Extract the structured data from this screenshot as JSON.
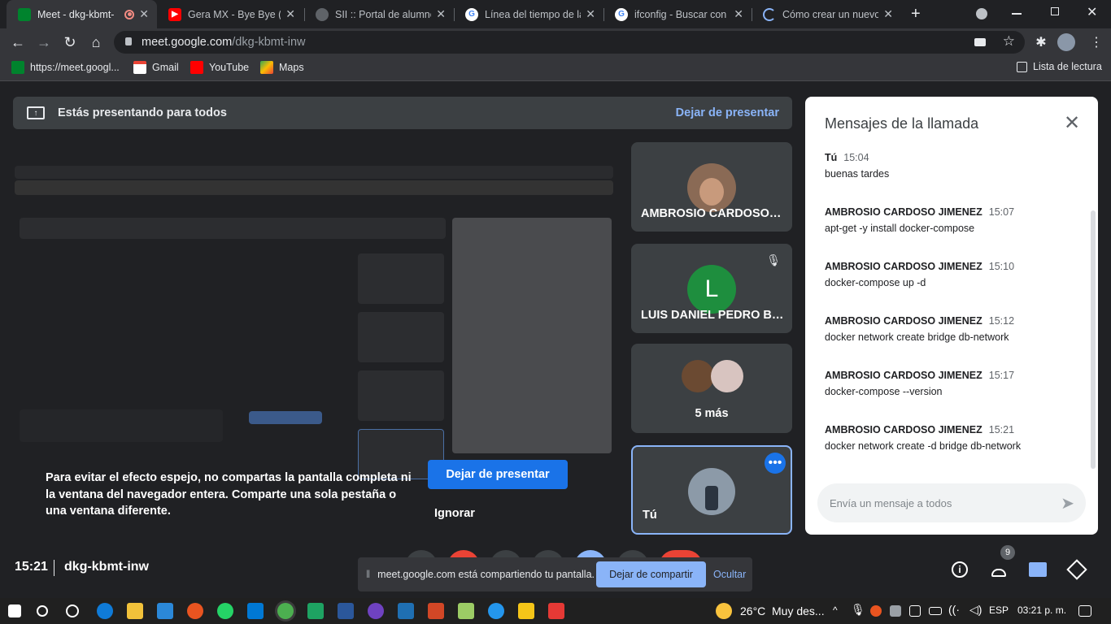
{
  "browser": {
    "tabs": [
      {
        "title": "Meet - dkg-kbmt-",
        "favicon": "meet-icon",
        "active": true
      },
      {
        "title": "Gera MX - Bye Bye (Vi",
        "favicon": "youtube-icon"
      },
      {
        "title": "SII :: Portal de alumnos",
        "favicon": "globe-icon"
      },
      {
        "title": "Línea del tiempo de la",
        "favicon": "google-icon"
      },
      {
        "title": "ifconfig - Buscar con G",
        "favicon": "google-icon"
      },
      {
        "title": "Cómo crear un nuevo",
        "favicon": "loading-icon"
      }
    ],
    "url_host": "meet.google.com",
    "url_path": "/dkg-kbmt-inw",
    "bookmarks": [
      {
        "label": "https://meet.googl...",
        "icon": "meet-icon"
      },
      {
        "label": "Gmail",
        "icon": "gmail-icon"
      },
      {
        "label": "YouTube",
        "icon": "youtube-icon"
      },
      {
        "label": "Maps",
        "icon": "maps-icon"
      }
    ],
    "reading_list": "Lista de lectura"
  },
  "meet": {
    "presenting_banner": "Estás presentando para todos",
    "stop_presenting_link": "Dejar de presentar",
    "warning_text": "Para evitar el efecto espejo, no compartas la pantalla completa ni la ventana del navegador entera. Comparte una sola pestaña o una ventana diferente.",
    "stop_presenting_button": "Dejar de presentar",
    "ignore": "Ignorar",
    "participants": [
      {
        "name": "AMBROSIO CARDOSO J...",
        "initial": ""
      },
      {
        "name": "LUIS DANIEL PEDRO BO...",
        "initial": "L",
        "muted": true
      },
      {
        "name": "5 más"
      },
      {
        "name": "Tú"
      }
    ],
    "clock": "15:21",
    "meeting_code": "dkg-kbmt-inw",
    "participant_count": "9",
    "share_banner": {
      "text": "meet.google.com está compartiendo tu pantalla.",
      "stop": "Dejar de compartir",
      "hide": "Ocultar"
    }
  },
  "chat": {
    "title": "Mensajes de la llamada",
    "messages": [
      {
        "sender": "Tú",
        "time": "15:04",
        "text": "buenas tardes"
      },
      {
        "sender": "AMBROSIO CARDOSO JIMENEZ",
        "time": "15:07",
        "text": "apt-get -y install docker-compose"
      },
      {
        "sender": "AMBROSIO CARDOSO JIMENEZ",
        "time": "15:10",
        "text": "docker-compose up -d"
      },
      {
        "sender": "AMBROSIO CARDOSO JIMENEZ",
        "time": "15:12",
        "text": "docker network create bridge db-network"
      },
      {
        "sender": "AMBROSIO CARDOSO JIMENEZ",
        "time": "15:17",
        "text": "docker-compose --version"
      },
      {
        "sender": "AMBROSIO CARDOSO JIMENEZ",
        "time": "15:21",
        "text": "docker network create -d bridge db-network"
      }
    ],
    "input_placeholder": "Envía un mensaje a todos"
  },
  "taskbar": {
    "weather": "26°C",
    "weather_desc": "Muy des...",
    "lang": "ESP",
    "time": "03:21 p. m."
  },
  "colors": {
    "accent": "#1a73e8",
    "link": "#8ab4f8",
    "green_avatar": "#1e8e3e"
  }
}
